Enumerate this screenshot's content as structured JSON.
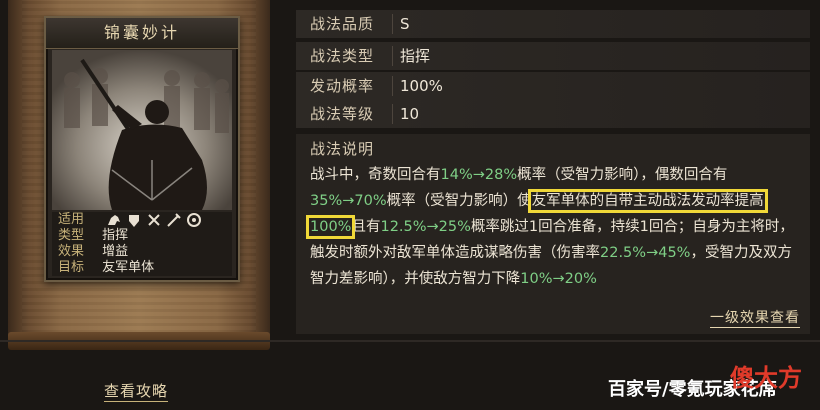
{
  "card": {
    "title": "锦囊妙计",
    "stats": [
      {
        "label": "适用",
        "value": ""
      },
      {
        "label": "类型",
        "value": "指挥"
      },
      {
        "label": "效果",
        "value": "增益"
      },
      {
        "label": "目标",
        "value": "友军单体"
      }
    ],
    "unit_icons": [
      "cavalry-icon",
      "shield-icon",
      "bow-icon",
      "spear-icon",
      "wheel-icon"
    ]
  },
  "info": {
    "rows": [
      {
        "label": "战法品质",
        "value": "S"
      },
      {
        "label": "战法类型",
        "value": "指挥"
      },
      {
        "label": "发动概率",
        "value": "100%"
      },
      {
        "label": "战法等级",
        "value": "10"
      }
    ]
  },
  "description": {
    "title": "战法说明",
    "parts": {
      "p1": "战斗中，奇数回合有",
      "p2": "14%→28%",
      "p3": "概率（受智力影响），偶数回合有",
      "p4": "35%→70%",
      "p5": "概率（受智力影响）使",
      "p6": "友军单体的自带主动战法发动率提高",
      "p7": "100%",
      "p8": "且有",
      "p9": "12.5%→25%",
      "p10": "概率跳过1回合准备，持续1回合；自身为主将时，触发时额外对敌军单体造成谋略伤害（伤害率",
      "p11": "22.5%→45%",
      "p12": "，受智力及双方智力差影响），并使敌方智力下降",
      "p13": "10%→20%"
    },
    "effect_link": "一级效果查看"
  },
  "footer": {
    "guide_link": "查看攻略",
    "watermark": "百家号/零氪玩家花席",
    "logo_text": "傻大方"
  },
  "colors": {
    "green": "#7fcf86",
    "highlight": "#f0d838",
    "gold_text": "#e6d6b0"
  }
}
